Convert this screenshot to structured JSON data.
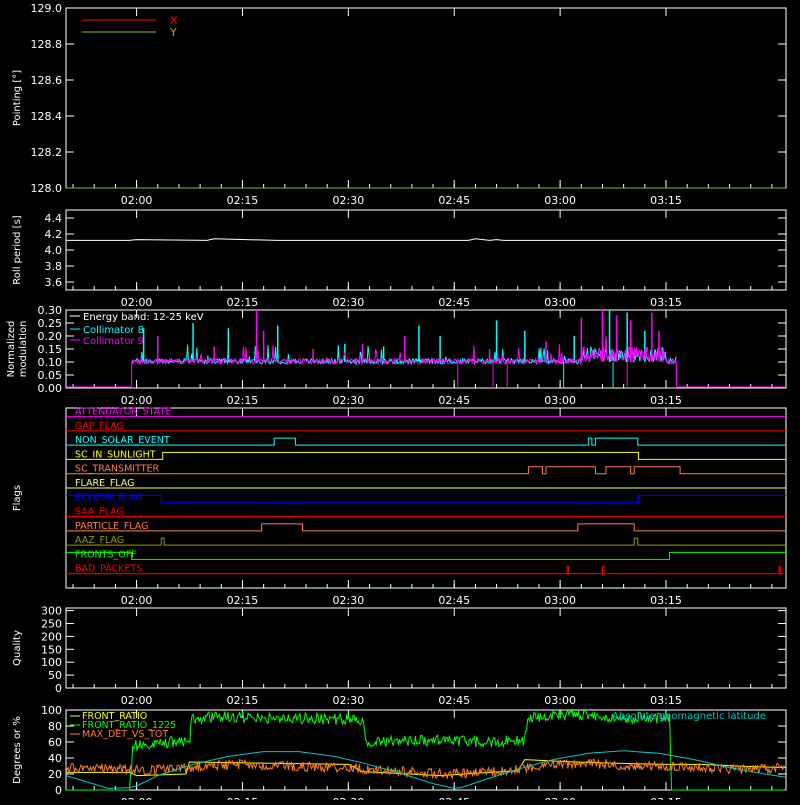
{
  "time_axis": {
    "tick_labels": [
      "02:00",
      "02:15",
      "02:30",
      "02:45",
      "03:00",
      "03:15"
    ],
    "tick_values_min": [
      120,
      135,
      150,
      165,
      180,
      195
    ],
    "range_min": [
      110,
      212
    ]
  },
  "chart_data": [
    {
      "id": "pointing",
      "type": "line",
      "ylabel": "Pointing [°]",
      "ylim": [
        128.0,
        129.0
      ],
      "ytick_labels": [
        "128.0",
        "128.2",
        "128.4",
        "128.6",
        "128.8",
        "129.0"
      ],
      "ytick_values": [
        128.0,
        128.2,
        128.4,
        128.6,
        128.8,
        129.0
      ],
      "legend": "top-left",
      "series": [
        {
          "name": "X",
          "color": "#ff0000",
          "x": [
            110,
            212
          ],
          "y": [
            128.0,
            128.0
          ]
        },
        {
          "name": "Y",
          "color": "#b0b000",
          "x": [
            110,
            212
          ],
          "y": [
            128.0,
            128.0
          ]
        }
      ]
    },
    {
      "id": "roll",
      "type": "line",
      "ylabel": "Roll period [s]",
      "ylim": [
        3.5,
        4.5
      ],
      "ytick_labels": [
        "3.6",
        "3.8",
        "4.0",
        "4.2",
        "4.4"
      ],
      "ytick_values": [
        3.6,
        3.8,
        4.0,
        4.2,
        4.4
      ],
      "series": [
        {
          "color": "#ffffff",
          "x": [
            110,
            119,
            120,
            130,
            131,
            140,
            150,
            160,
            167,
            168,
            170,
            171,
            172,
            180,
            190,
            200,
            212
          ],
          "y": [
            4.12,
            4.12,
            4.13,
            4.12,
            4.14,
            4.12,
            4.12,
            4.12,
            4.12,
            4.14,
            4.12,
            4.13,
            4.12,
            4.12,
            4.12,
            4.12,
            4.12
          ]
        }
      ]
    },
    {
      "id": "modulation",
      "type": "line",
      "ylabel": "Normalized modulation",
      "ylim": [
        0.0,
        0.3
      ],
      "ytick_labels": [
        "0.00",
        "0.05",
        "0.10",
        "0.15",
        "0.20",
        "0.25",
        "0.30"
      ],
      "ytick_values": [
        0.0,
        0.05,
        0.1,
        0.15,
        0.2,
        0.25,
        0.3
      ],
      "annotation": "Energy band: 12-25 keV",
      "legend": "top-left",
      "active_range_min": [
        119.3,
        196.5
      ],
      "baseline": 0.1,
      "series": [
        {
          "name": "Collimator 8",
          "color": "#00ffff",
          "spikes_x": [
            121,
            128,
            133,
            140,
            149.5,
            155,
            160,
            163,
            171,
            175,
            182,
            187,
            189.5,
            192
          ],
          "spikes_y": [
            0.23,
            0.25,
            0.23,
            0.24,
            0.17,
            0.16,
            0.24,
            0.2,
            0.26,
            0.22,
            0.2,
            0.3,
            0.29,
            0.22
          ]
        },
        {
          "name": "Collimator 9",
          "color": "#ff00ff",
          "spikes_x": [
            123,
            131,
            137,
            138,
            145,
            152,
            158,
            170,
            178,
            183,
            186,
            188,
            190,
            193,
            194
          ],
          "spikes_y": [
            0.2,
            0.16,
            0.3,
            0.22,
            0.15,
            0.17,
            0.2,
            0.15,
            0.18,
            0.27,
            0.3,
            0.28,
            0.26,
            0.29,
            0.22
          ]
        }
      ]
    },
    {
      "id": "flags",
      "type": "line",
      "ylabel": "Flags",
      "ylim": [
        0,
        12.6
      ],
      "series": [
        {
          "name": "ATTENUATOR_STATE",
          "color": "#ff00ff",
          "level": 12,
          "x": [
            110,
            212
          ],
          "v": [
            0,
            0
          ]
        },
        {
          "name": "GAP_FLAG",
          "color": "#ff0000",
          "level": 11,
          "x": [
            110,
            212
          ],
          "v": [
            0,
            0
          ]
        },
        {
          "name": "NON_SOLAR_EVENT",
          "color": "#00ffff",
          "level": 10,
          "x": [
            110,
            139.5,
            139.5,
            142.5,
            142.5,
            184,
            184,
            184.5,
            184.5,
            185,
            185,
            185.5,
            185.5,
            191,
            191,
            212
          ],
          "v": [
            0,
            0,
            1,
            1,
            0,
            0,
            1,
            1,
            0,
            0,
            1,
            1,
            1,
            1,
            0,
            0
          ]
        },
        {
          "name": "SC_IN_SUNLIGHT",
          "color": "#ffff00",
          "level": 9,
          "x": [
            110,
            123.7,
            123.7,
            191.1,
            191.1,
            212
          ],
          "v": [
            0,
            0,
            1,
            1,
            0,
            0
          ]
        },
        {
          "name": "SC_TRANSMITTER",
          "color": "#ff7f3f",
          "level": 8,
          "x": [
            110,
            175.5,
            175.5,
            177.5,
            177.5,
            178,
            178,
            185,
            185,
            186.5,
            186.5,
            190,
            190,
            190.5,
            190.5,
            197,
            197,
            212
          ],
          "v": [
            0,
            0,
            1,
            1,
            0,
            0,
            1,
            1,
            0,
            0,
            1,
            1,
            0,
            0,
            1,
            1,
            0,
            0
          ]
        },
        {
          "name": "FLARE_FLAG",
          "color": "#ffff66",
          "level": 7,
          "x": [
            110,
            212
          ],
          "v": [
            0,
            0
          ]
        },
        {
          "name": "ECLIPSE_FLAG",
          "color": "#0000ff",
          "level": 6,
          "x": [
            110,
            123.5,
            123.5,
            191.1,
            191.1,
            212
          ],
          "v": [
            1,
            1,
            0,
            0,
            1,
            1
          ]
        },
        {
          "name": "SAA_FLAG",
          "color": "#ff0000",
          "level": 5,
          "x": [
            110,
            212
          ],
          "v": [
            0,
            0
          ]
        },
        {
          "name": "PARTICLE_FLAG",
          "color": "#ff7f3f",
          "level": 4,
          "x": [
            110,
            137.7,
            137.7,
            143.5,
            143.5,
            182.5,
            182.5,
            190.5,
            190.5,
            212
          ],
          "v": [
            0,
            0,
            1,
            1,
            0,
            0,
            1,
            1,
            0,
            0
          ]
        },
        {
          "name": "AAZ_FLAG",
          "color": "#999900",
          "level": 3,
          "x": [
            110,
            123.5,
            123.5,
            123.9,
            123.9,
            190.5,
            190.5,
            191,
            191,
            212
          ],
          "v": [
            0,
            0,
            1,
            1,
            0,
            0,
            1,
            1,
            0,
            0
          ]
        },
        {
          "name": "FRONTS_OFF",
          "color": "#00ff00",
          "level": 2,
          "x": [
            110,
            119.3,
            119.3,
            195.5,
            195.5,
            212
          ],
          "v": [
            1,
            1,
            0,
            0,
            1,
            1
          ]
        },
        {
          "name": "BAD_PACKETS",
          "color": "#ff0000",
          "level": 1,
          "x": [
            110,
            181,
            181,
            181.2,
            181.2,
            186,
            186,
            186.2,
            186.2,
            211,
            211,
            211.2,
            211.2,
            212
          ],
          "v": [
            0,
            0,
            1,
            1,
            0,
            0,
            1,
            1,
            0,
            0,
            1,
            1,
            0,
            0
          ]
        }
      ]
    },
    {
      "id": "quality",
      "type": "line",
      "ylabel": "Quality",
      "ylim": [
        0,
        310
      ],
      "ytick_labels": [
        "0",
        "50",
        "100",
        "150",
        "200",
        "250",
        "300"
      ],
      "ytick_values": [
        0,
        50,
        100,
        150,
        200,
        250,
        300
      ],
      "series": []
    },
    {
      "id": "degrees",
      "type": "line",
      "ylabel": "Degrees or %",
      "ylim": [
        0,
        100
      ],
      "ytick_labels": [
        "0",
        "20",
        "40",
        "60",
        "80",
        "100"
      ],
      "ytick_values": [
        0,
        20,
        40,
        60,
        80,
        100
      ],
      "legend": "top-left",
      "series": [
        {
          "name": "FRONT_RATIO",
          "color": "#ffff00",
          "x": [
            110,
            119,
            120,
            127,
            127.5,
            150,
            152,
            163,
            170,
            174,
            175,
            182,
            190,
            195,
            200,
            205,
            212
          ],
          "y": [
            22,
            22,
            18,
            20,
            35,
            32,
            23,
            18,
            22,
            24,
            38,
            35,
            33,
            32,
            32,
            30,
            28
          ]
        },
        {
          "name": "FRONT_RATIO_1225",
          "color": "#00ff00",
          "x": [
            110,
            119,
            119.5,
            124,
            127.5,
            127.8,
            133,
            140,
            150,
            152,
            152.5,
            160,
            170,
            174,
            175,
            175.5,
            182,
            190,
            195.5,
            195.8,
            212
          ],
          "y": [
            0,
            0,
            55,
            60,
            60,
            90,
            92,
            90,
            88,
            88,
            60,
            62,
            60,
            62,
            62,
            90,
            95,
            90,
            90,
            0,
            0
          ]
        },
        {
          "name": "MAX_DET_VS_TOT",
          "color": "#ff7f1f",
          "x": [
            110,
            115,
            120,
            125,
            130,
            135,
            140,
            145,
            150,
            155,
            160,
            165,
            170,
            175,
            180,
            185,
            190,
            195,
            200,
            205,
            212
          ],
          "y": [
            28,
            27,
            25,
            26,
            30,
            32,
            30,
            29,
            28,
            24,
            22,
            20,
            22,
            28,
            32,
            33,
            30,
            30,
            28,
            26,
            27
          ]
        },
        {
          "name": "Absolute geomagnetic latitude",
          "color": "#00c8c8",
          "x": [
            110,
            113,
            116,
            119,
            120,
            123,
            128,
            133,
            138,
            143,
            148,
            152,
            157,
            162,
            165,
            166,
            169,
            174,
            179,
            184,
            189,
            194,
            199,
            204,
            209,
            212
          ],
          "y": [
            18,
            10,
            2,
            3,
            5,
            18,
            32,
            42,
            48,
            48,
            42,
            34,
            22,
            8,
            2,
            3,
            12,
            26,
            38,
            46,
            49,
            46,
            38,
            28,
            20,
            16
          ]
        }
      ]
    }
  ]
}
